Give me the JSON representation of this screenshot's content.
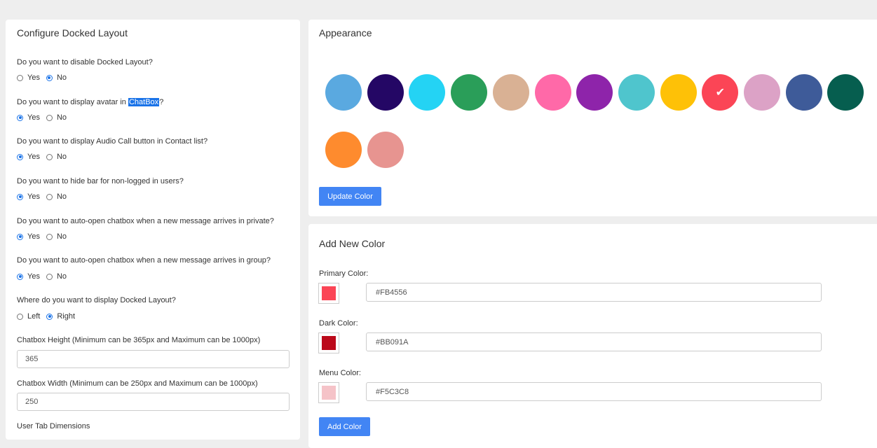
{
  "docked": {
    "title": "Configure Docked Layout",
    "questions": [
      {
        "text": "Do you want to disable Docked Layout?",
        "options": [
          "Yes",
          "No"
        ],
        "selected": 1
      },
      {
        "text_before": "Do you want to display avatar in ",
        "highlight": "ChatBox",
        "text_after": "?",
        "options": [
          "Yes",
          "No"
        ],
        "selected": 0
      },
      {
        "text": "Do you want to display Audio Call button in Contact list?",
        "options": [
          "Yes",
          "No"
        ],
        "selected": 0
      },
      {
        "text": "Do you want to hide bar for non-logged in users?",
        "options": [
          "Yes",
          "No"
        ],
        "selected": 0
      },
      {
        "text": "Do you want to auto-open chatbox when a new message arrives in private?",
        "options": [
          "Yes",
          "No"
        ],
        "selected": 0
      },
      {
        "text": "Do you want to auto-open chatbox when a new message arrives in group?",
        "options": [
          "Yes",
          "No"
        ],
        "selected": 0
      },
      {
        "text": "Where do you want to display Docked Layout?",
        "options": [
          "Left",
          "Right"
        ],
        "selected": 1
      }
    ],
    "height_label": "Chatbox Height (Minimum can be 365px and Maximum can be 1000px)",
    "height_value": "365",
    "width_label": "Chatbox Width (Minimum can be 250px and Maximum can be 1000px)",
    "width_value": "250",
    "user_tab_label": "User Tab Dimensions"
  },
  "appearance": {
    "title": "Appearance",
    "selected_index": 9,
    "swatches": [
      "#5aa9e0",
      "#240765",
      "#24d3f4",
      "#2a9e59",
      "#d9b194",
      "#ff69a8",
      "#8e24aa",
      "#4fc5cd",
      "#fec107",
      "#fb4556",
      "#dca2c6",
      "#3e5b99",
      "#065e4f",
      "#fe8b2e",
      "#e79490"
    ],
    "check_icon": "check-icon",
    "update_button": "Update Color"
  },
  "add_color": {
    "title": "Add New Color",
    "fields": [
      {
        "label": "Primary Color:",
        "value": "#FB4556",
        "color": "#FB4556"
      },
      {
        "label": "Dark Color:",
        "value": "#BB091A",
        "color": "#BB091A"
      },
      {
        "label": "Menu Color:",
        "value": "#F5C3C8",
        "color": "#F5C3C8"
      }
    ],
    "add_button": "Add Color"
  }
}
